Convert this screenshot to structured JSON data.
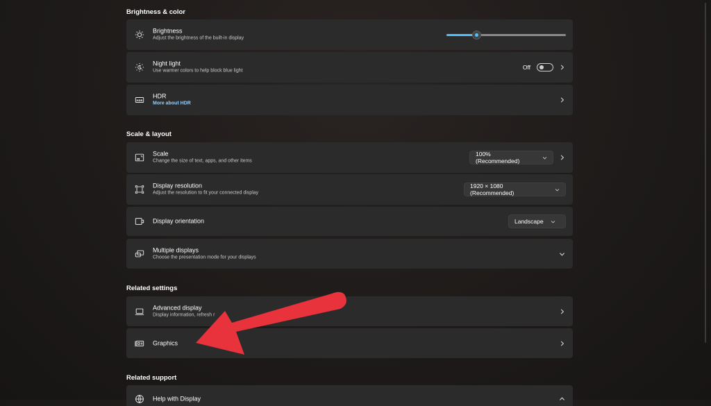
{
  "sections": {
    "brightness_color": "Brightness & color",
    "scale_layout": "Scale & layout",
    "related_settings": "Related settings",
    "related_support": "Related support"
  },
  "brightness": {
    "label": "Brightness",
    "desc": "Adjust the brightness of the built-in display",
    "value_fraction": 0.25
  },
  "night_light": {
    "label": "Night light",
    "desc": "Use warmer colors to help block blue light",
    "state": "Off"
  },
  "hdr": {
    "label": "HDR",
    "link": "More about HDR"
  },
  "scale": {
    "label": "Scale",
    "desc": "Change the size of text, apps, and other items",
    "value": "100% (Recommended)"
  },
  "resolution": {
    "label": "Display resolution",
    "desc": "Adjust the resolution to fit your connected display",
    "value": "1920 × 1080 (Recommended)"
  },
  "orientation": {
    "label": "Display orientation",
    "value": "Landscape"
  },
  "multiple": {
    "label": "Multiple displays",
    "desc": "Choose the presentation mode for your displays"
  },
  "advanced": {
    "label": "Advanced display",
    "desc": "Display information, refresh r"
  },
  "graphics": {
    "label": "Graphics"
  },
  "help": {
    "label": "Help with Display"
  },
  "colors": {
    "accent": "#4cc2ff",
    "annotation_arrow": "#e8323c",
    "card": "#2b2b2b"
  }
}
